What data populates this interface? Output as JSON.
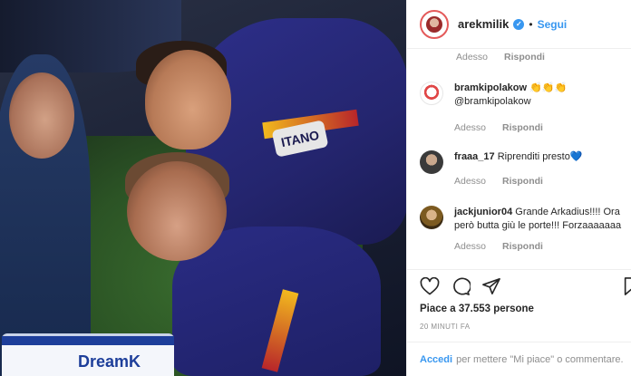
{
  "photo": {
    "armband_text": "ITANO",
    "kitbag_brand": "Dream",
    "kitbag_brand_suffix": "K"
  },
  "header": {
    "username": "arekmilik",
    "separator": "•",
    "follow_label": "Segui"
  },
  "comments": [
    {
      "username": "",
      "text": "",
      "time": "Adesso",
      "reply_label": "Rispondi",
      "avatar_icon": "none"
    },
    {
      "username": "bramkipolakow",
      "text": "👏👏👏 @bramkipolakow",
      "time": "Adesso",
      "reply_label": "Rispondi",
      "avatar_icon": "bramkipolakow-avatar"
    },
    {
      "username": "fraaa_17",
      "text": "Riprenditi presto",
      "emoji": "💙",
      "time": "Adesso",
      "reply_label": "Rispondi",
      "avatar_icon": "fraaa-avatar"
    },
    {
      "username": "jackjunior04",
      "text": "Grande Arkadius!!!! Ora però butta giù le porte!!! Forzaaaaaaa",
      "time": "Adesso",
      "reply_label": "Rispondi",
      "avatar_icon": "jackjunior-avatar"
    }
  ],
  "actions": {
    "likes_text": "Piace a 37.553 persone",
    "timestamp": "20 MINUTI FA",
    "icons": [
      "heart-icon",
      "comment-icon",
      "share-icon",
      "bookmark-icon"
    ]
  },
  "add_comment": {
    "login_label": "Accedi",
    "prompt": "per mettere \"Mi piace\" o commentare."
  },
  "colors": {
    "link_blue": "#3897f0",
    "muted_gray": "#8e8e8e",
    "text_dark": "#262626",
    "border": "#efefef"
  }
}
